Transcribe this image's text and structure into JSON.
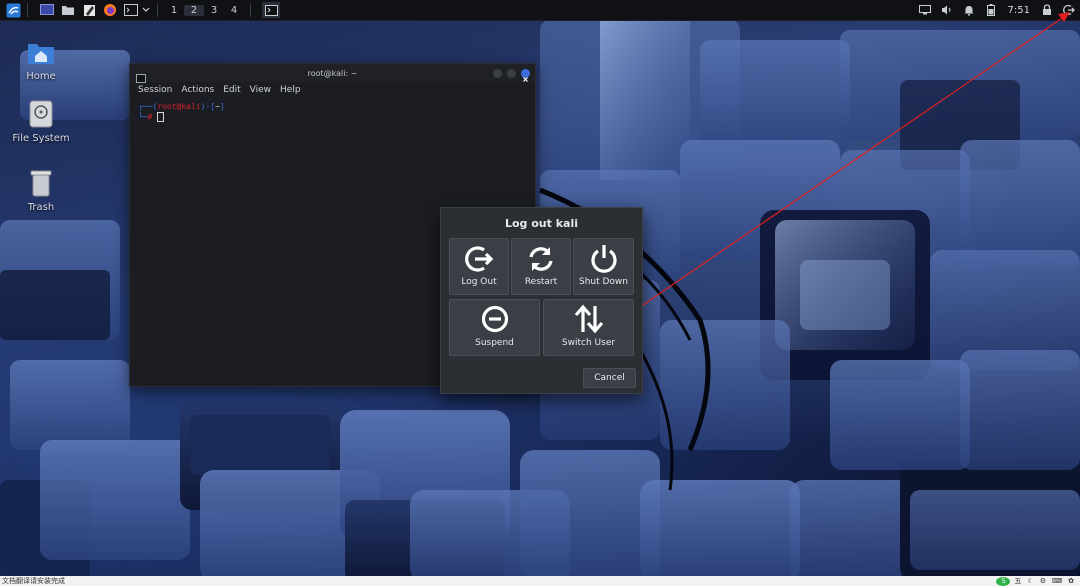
{
  "top_panel": {
    "workspaces": [
      "1",
      "2",
      "3",
      "4"
    ],
    "active_workspace": "2",
    "clock": "7:51",
    "icons": {
      "menu": "kali-menu-icon",
      "show_desktop": "desktop-icon",
      "file_manager": "folder-icon",
      "text_editor": "text-editor-icon",
      "browser": "firefox-icon",
      "terminal": "terminal-icon",
      "dropdown": "chevron-down-icon",
      "task_terminal": "terminal-task-icon",
      "display": "display-icon",
      "volume": "volume-icon",
      "notifications": "bell-icon",
      "battery": "battery-icon",
      "lock": "lock-icon",
      "logout": "logout-icon"
    }
  },
  "desktop": {
    "icons": [
      {
        "label": "Home",
        "icon": "home-folder-icon"
      },
      {
        "label": "File System",
        "icon": "drive-icon"
      },
      {
        "label": "Trash",
        "icon": "trash-icon"
      }
    ]
  },
  "terminal": {
    "title": "root@kali: ~",
    "menu": [
      "Session",
      "Actions",
      "Edit",
      "View",
      "Help"
    ],
    "prompt_user": "root@kali",
    "prompt_dir": "~",
    "prompt_symbol": "#"
  },
  "logout_dialog": {
    "title": "Log out kali",
    "buttons": [
      {
        "label": "Log Out",
        "icon": "logout-icon"
      },
      {
        "label": "Restart",
        "icon": "restart-icon"
      },
      {
        "label": "Shut Down",
        "icon": "power-icon"
      },
      {
        "label": "Suspend",
        "icon": "suspend-icon"
      },
      {
        "label": "Switch User",
        "icon": "switch-user-icon"
      }
    ],
    "cancel_label": "Cancel"
  },
  "bottom_bar": {
    "left_text": "文档翻译请安装完成",
    "ime_label": "五"
  },
  "colors": {
    "panel": "#0f1115",
    "dialog": "#2b2e33",
    "dialog_button": "#3a3e45",
    "terminal_bg": "#1b1d22",
    "prompt_red": "#d8212b",
    "prompt_blue": "#3b6edc",
    "annotation_arrow": "#e02020"
  }
}
